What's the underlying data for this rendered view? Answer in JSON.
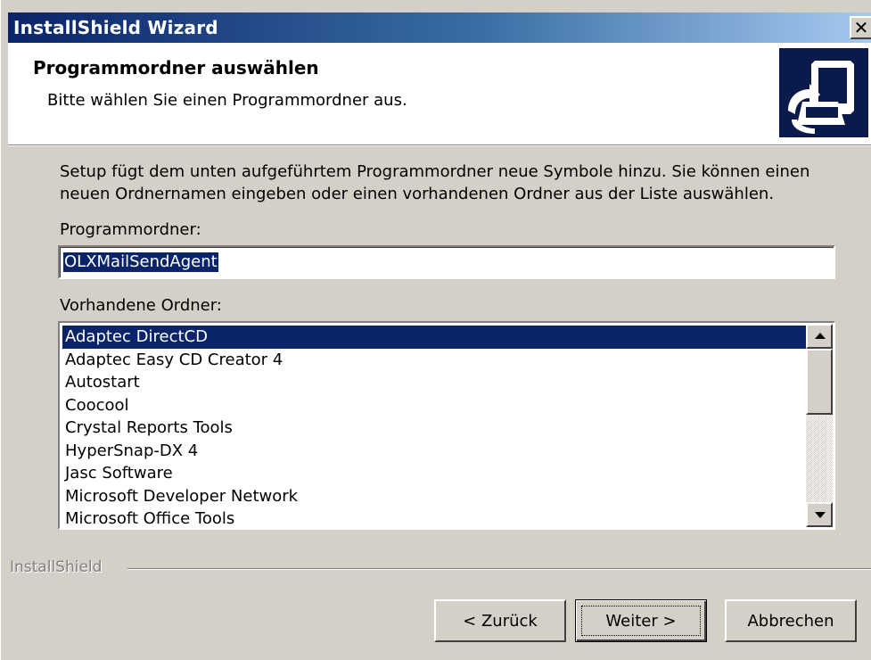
{
  "window": {
    "title": "InstallShield Wizard"
  },
  "header": {
    "title": "Programmordner auswählen",
    "subtitle": "Bitte wählen Sie einen Programmordner aus."
  },
  "body": {
    "description": "Setup fügt dem unten aufgeführtem Programmordner neue Symbole hinzu. Sie können einen neuen Ordnernamen eingeben oder einen vorhandenen Ordner aus der Liste auswählen.",
    "program_folder_label": "Programmordner:",
    "program_folder_value": "OLXMailSendAgent",
    "existing_folders_label": "Vorhandene Ordner:",
    "existing_folders": [
      "Adaptec DirectCD",
      "Adaptec Easy CD Creator 4",
      "Autostart",
      "Coocool",
      "Crystal Reports Tools",
      "HyperSnap-DX 4",
      "Jasc Software",
      "Microsoft Developer Network",
      "Microsoft Office Tools"
    ],
    "selected_folder_index": 0
  },
  "footer": {
    "brand": "InstallShield",
    "back_label": "< Zurück",
    "next_label": "Weiter >",
    "cancel_label": "Abbrechen"
  },
  "icons": {
    "close": "close-icon",
    "setup": "setup-computer-icon",
    "scroll_up": "scroll-up-arrow-icon",
    "scroll_down": "scroll-down-arrow-icon"
  },
  "colors": {
    "title_gradient_start": "#0a246a",
    "title_gradient_end": "#a6caf0",
    "selection": "#0a246a",
    "dialog_face": "#d4d0c8"
  }
}
